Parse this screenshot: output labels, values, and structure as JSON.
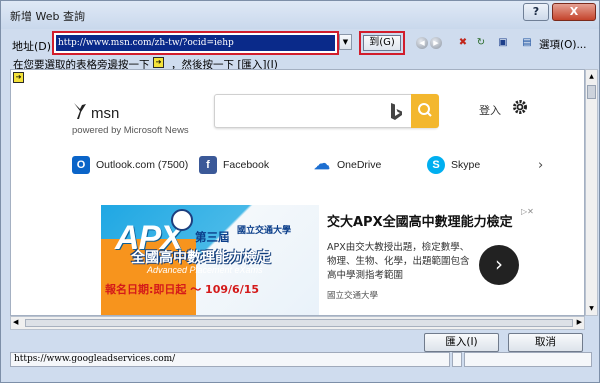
{
  "window": {
    "title": "新增 Web 查詢",
    "help_label": "?",
    "close_label": "X"
  },
  "address": {
    "label": "地址(D):",
    "value": "http://www.msn.com/zh-tw/?ocid=iehp",
    "go_label": "到(G)",
    "options_label": "選項(O)..."
  },
  "hint": {
    "part1": "在您要選取的表格旁邊按一下",
    "part2": "，然後按一下 [匯入](I)"
  },
  "msn": {
    "brand": "msn",
    "tagline": "powered by Microsoft News",
    "signin": "登入",
    "quick_links": [
      {
        "label": "Outlook.com (7500)",
        "color": "#0a64c8"
      },
      {
        "label": "Facebook",
        "color": "#3b5998"
      },
      {
        "label": "OneDrive",
        "color": "#1d6fd1"
      },
      {
        "label": "Skype",
        "color": "#00aff0"
      }
    ],
    "ad": {
      "image_apx": "APX",
      "image_session": "第三屆",
      "image_univ": "國立交通大學",
      "image_line1": "全國高中數理能力檢定",
      "image_line2": "Advanced Placement eXams",
      "image_line3": "報名日期:即日起 ～ 109/6/15",
      "title": "交大APX全國高中數理能力檢定",
      "description": "APX由交大教授出題，檢定數學、物理、生物、化學，出題範圍包含高中學測指考範圍",
      "source": "國立交通大學"
    }
  },
  "buttons": {
    "import": "匯入(I)",
    "cancel": "取消"
  },
  "status": {
    "text": "https://www.googleadservices.com/"
  }
}
